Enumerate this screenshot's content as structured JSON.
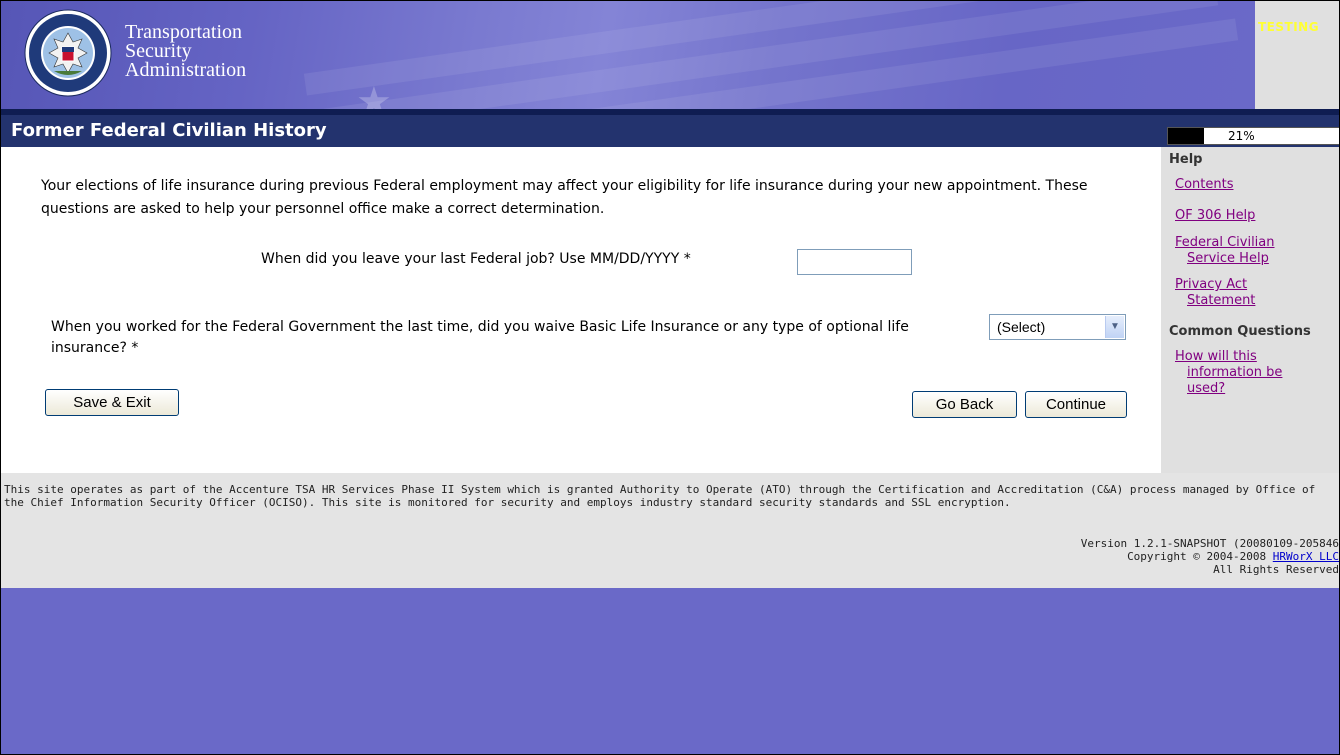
{
  "header": {
    "agency_line1": "Transportation",
    "agency_line2": "Security",
    "agency_line3": "Administration",
    "env_badge": "TESTING"
  },
  "title_bar": {
    "title": "Former Federal Civilian History",
    "progress_text": "21%",
    "progress_value": 0.21
  },
  "main": {
    "intro": "Your elections of life insurance during previous Federal employment may affect your eligibility for life insurance during your new appointment. These questions are asked to help your personnel office make a correct determination.",
    "q1_label": "When did you leave your last Federal job? Use MM/DD/YYYY *",
    "q1_value": "",
    "q2_label": "When you worked for the Federal Government the last time, did you waive Basic Life Insurance or any type of optional life insurance? *",
    "q2_selected": "(Select)",
    "save_exit_label": "Save & Exit",
    "go_back_label": "Go Back",
    "continue_label": "Continue"
  },
  "help": {
    "heading": "Help",
    "contents": "Contents",
    "of306": "OF 306 Help",
    "fed_civ_l1": "Federal Civilian",
    "fed_civ_l2": "Service Help",
    "privacy_l1": "Privacy Act",
    "privacy_l2": "Statement",
    "common_heading": "Common Questions",
    "how_l1": "How will this",
    "how_l2": "information be",
    "how_l3": "used?"
  },
  "footer": {
    "notice": "This site operates as part of the Accenture TSA HR Services Phase II System which is granted Authority to Operate (ATO) through the Certification and Accreditation (C&A) process managed by Office of the Chief Information Security Officer (OCISO). This site is monitored for security and employs industry standard security standards and SSL encryption.",
    "version": "Version 1.2.1-SNAPSHOT (20080109-205846",
    "copyright_prefix": "Copyright © 2004-2008 ",
    "company_link": "HRWorX LLC",
    "rights": "All Rights Reserved"
  },
  "colors": {
    "background": "#6a69c8",
    "title_bar": "#23336e",
    "help_panel": "#e0e0e0",
    "visited_link": "#800080",
    "testing_badge": "#ffff33"
  },
  "icons": {
    "seal": "dhs-seal-icon",
    "dropdown": "chevron-down-icon"
  }
}
